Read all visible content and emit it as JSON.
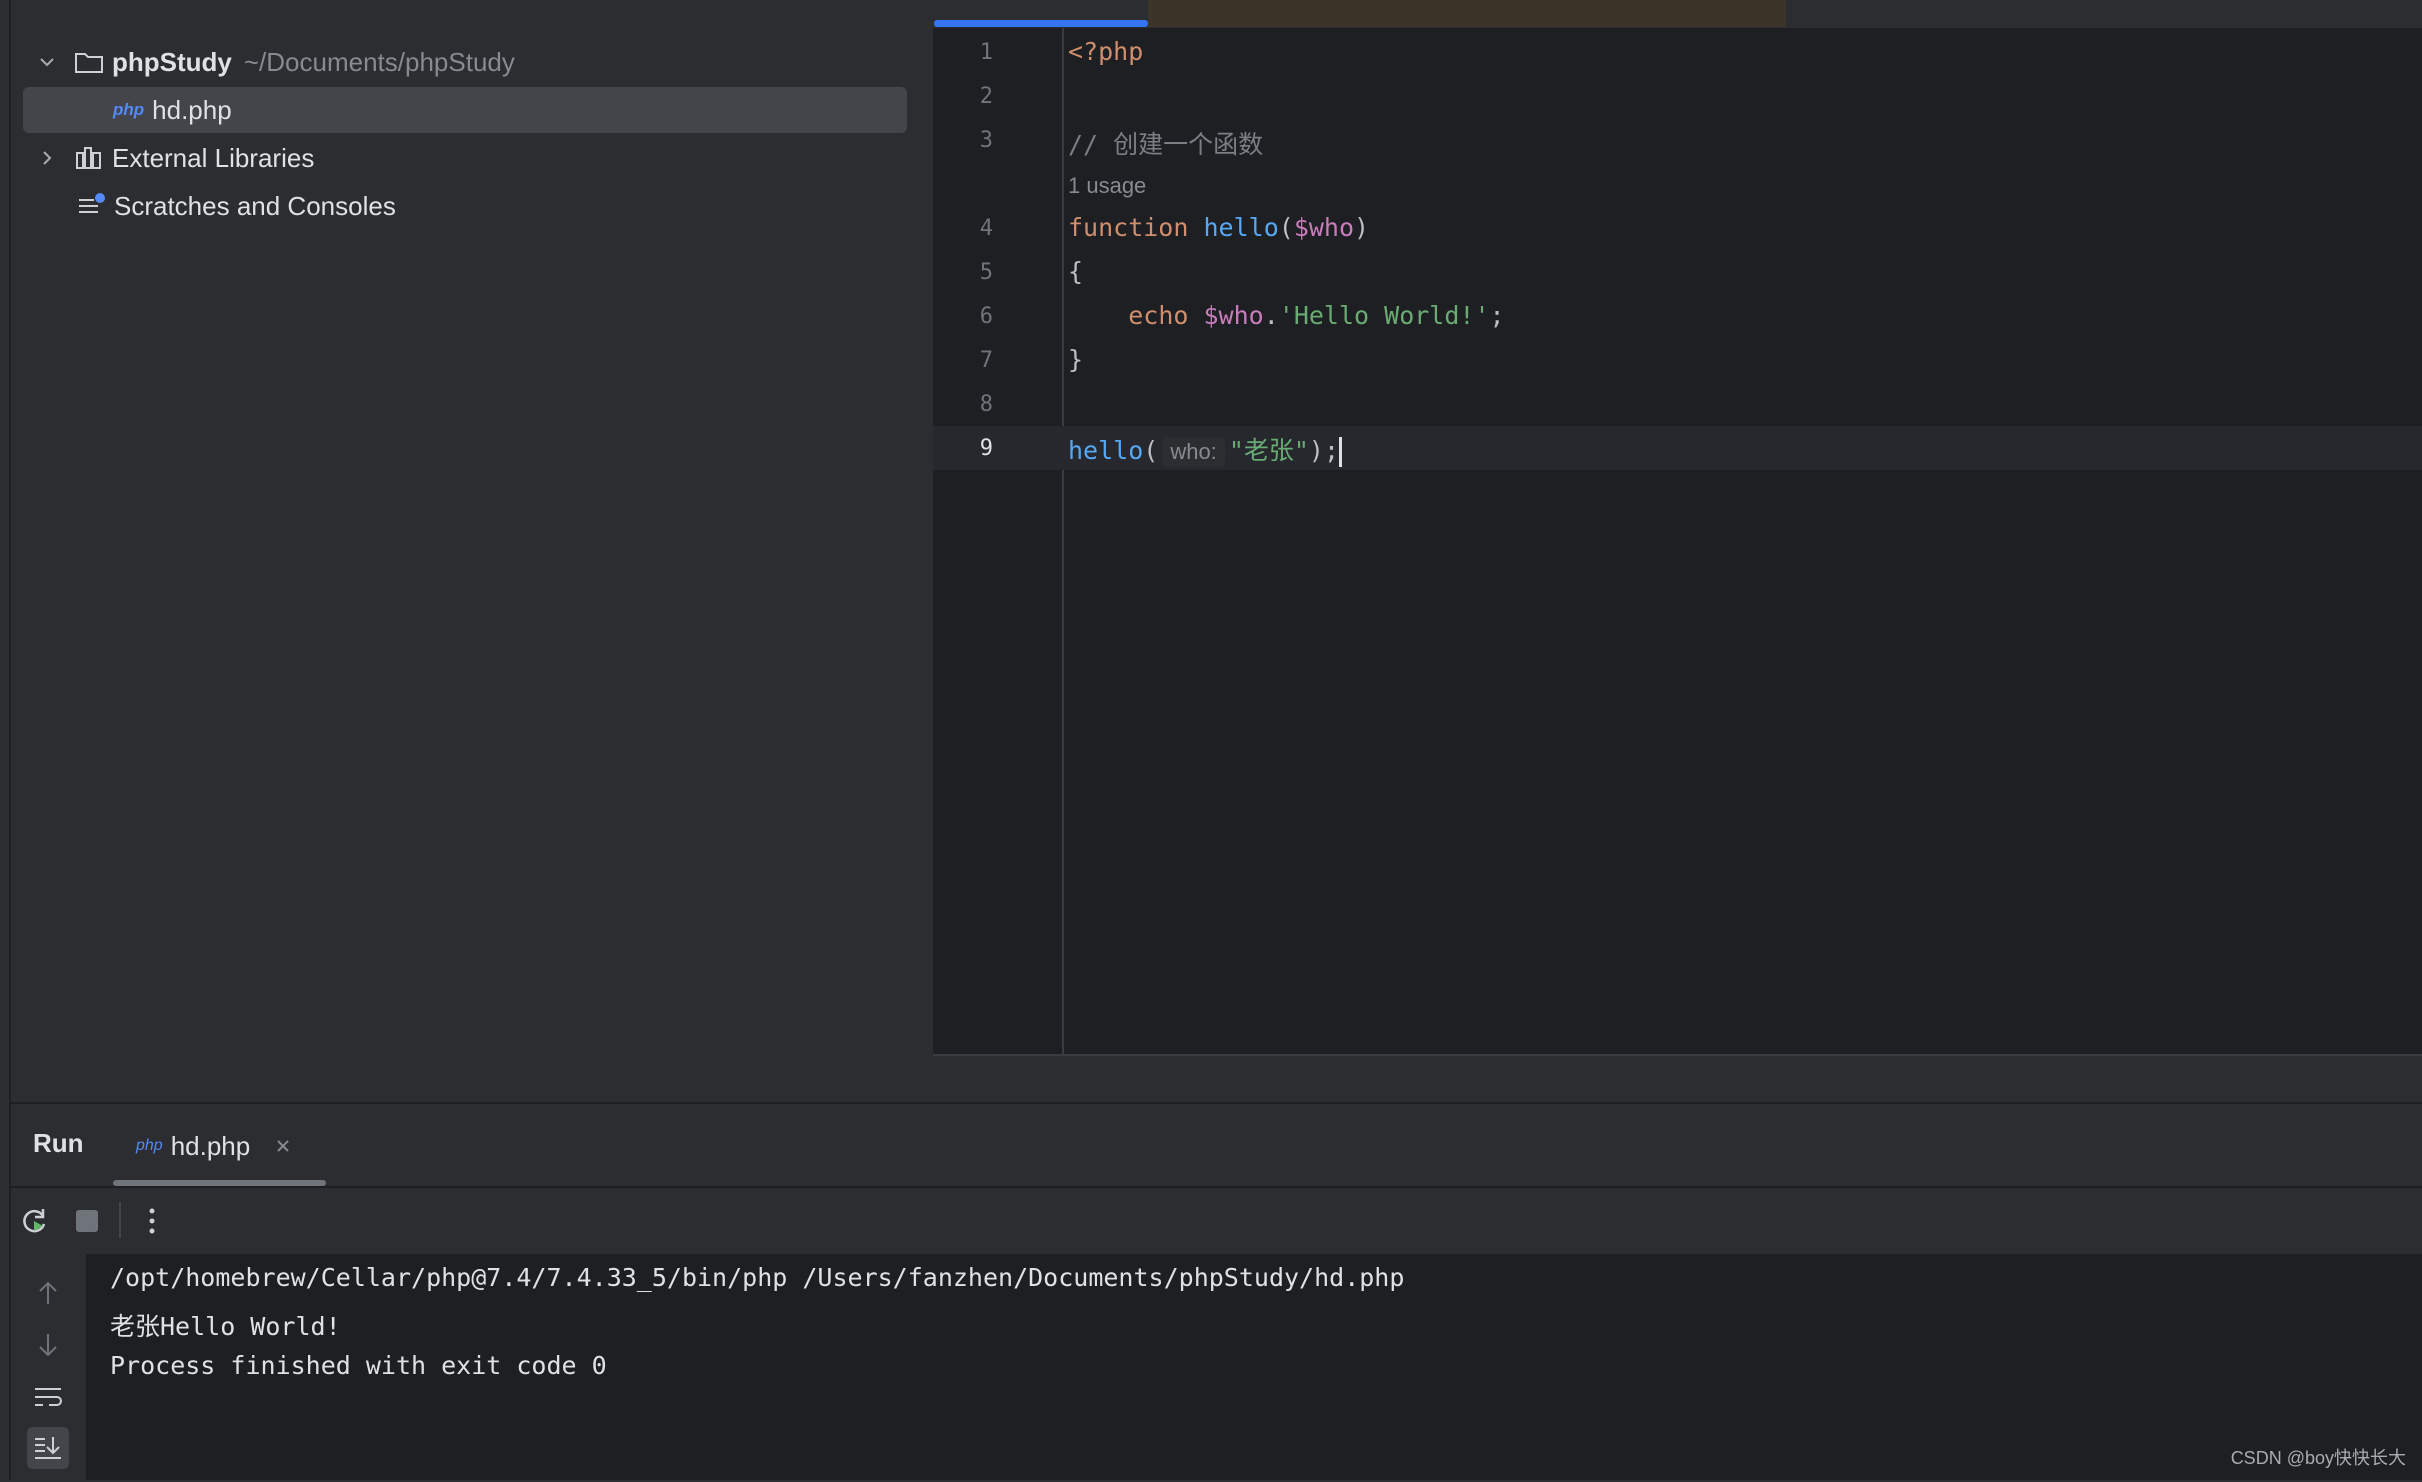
{
  "project_tree": {
    "root": {
      "name": "phpStudy",
      "path": "~/Documents/phpStudy"
    },
    "file": {
      "badge": "php",
      "name": "hd.php"
    },
    "external_libraries": "External Libraries",
    "scratches": "Scratches and Consoles"
  },
  "editor": {
    "line_numbers": [
      "1",
      "2",
      "3",
      "4",
      "5",
      "6",
      "7",
      "8",
      "9"
    ],
    "current_line": "9",
    "code": {
      "l1": "<?php",
      "l3": "// 创建一个函数",
      "usage_hint": "1 usage",
      "l4_kw": "function",
      "l4_fn": "hello",
      "l4_open": "(",
      "l4_var": "$who",
      "l4_close": ")",
      "l5": "{",
      "l6_kw": "echo",
      "l6_var": "$who",
      "l6_dot": ".",
      "l6_str": "'Hello World!'",
      "l6_semi": ";",
      "l7": "}",
      "l9_fn": "hello",
      "l9_open": "(",
      "l9_param_hint": "who:",
      "l9_str": "\"老张\"",
      "l9_close": ");"
    }
  },
  "run_panel": {
    "title": "Run",
    "tab_name": "hd.php",
    "output": [
      "/opt/homebrew/Cellar/php@7.4/7.4.33_5/bin/php /Users/fanzhen/Documents/phpStudy/hd.php",
      "老张Hello World!",
      "Process finished with exit code 0"
    ]
  },
  "watermark": "CSDN @boy快快长大",
  "colors": {
    "accent": "#3574f0",
    "keyword": "#cf8e6d",
    "function": "#56a8f5",
    "variable": "#c77dbb",
    "string": "#6aab73"
  }
}
